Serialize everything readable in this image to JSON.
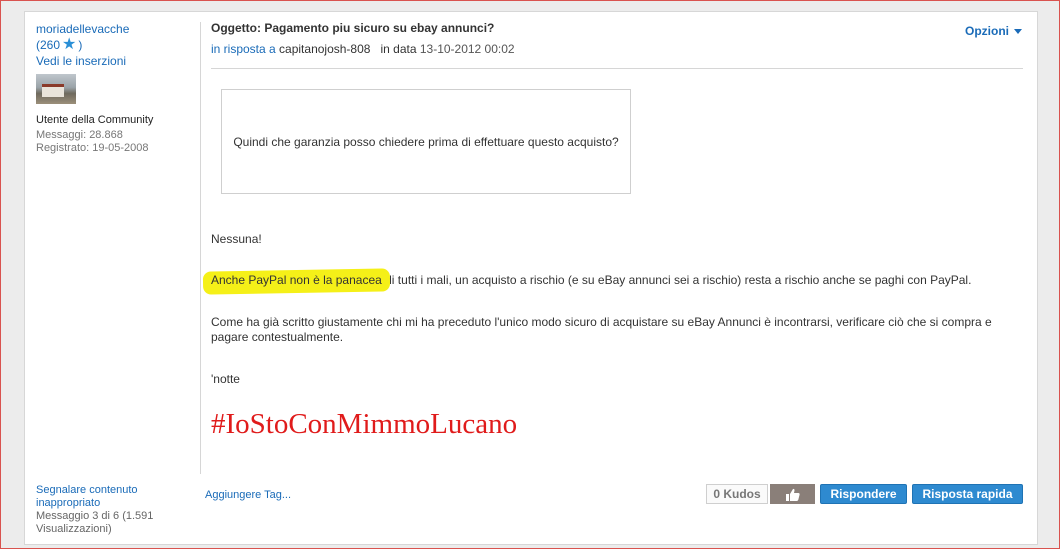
{
  "author": {
    "name": "moriadellevacche",
    "kudos_open": "(260",
    "kudos_close": ")",
    "see_posts": "Vedi le inserzioni",
    "role": "Utente della Community",
    "messages": "Messaggi: 28.868",
    "registered": "Registrato: 19-05-2008"
  },
  "post": {
    "subject": "Oggetto: Pagamento piu sicuro su ebay annunci?",
    "reply_prefix": "in risposta a",
    "reply_to": "capitanojosh-808",
    "date_prefix": "in data",
    "date": "13-10-2012 00:02",
    "options": "Opzioni",
    "quote": "Quindi che garanzia posso chiedere prima di effettuare questo acquisto?",
    "p1": "Nessuna!",
    "p2_highlight": "Anche PayPal non è la panacea",
    "p2_rest": " di tutti i mali, un acquisto a rischio (e su eBay annunci sei a rischio) resta a rischio anche se paghi con PayPal.",
    "p3": "Come ha già scritto giustamente chi mi ha preceduto l'unico modo sicuro di acquistare su eBay Annunci è incontrarsi, verificare ciò che si compra e pagare contestualmente.",
    "p4": "'notte",
    "hashtag": "#IoStoConMimmoLucano"
  },
  "footer": {
    "report": "Segnalare contenuto inappropriato",
    "message_count": "Messaggio 3 di 6 (1.591 Visualizzazioni)",
    "add_tag": "Aggiungere Tag...",
    "kudos": "0 Kudos",
    "reply": "Rispondere",
    "quick_reply": "Risposta rapida"
  },
  "colors": {
    "link": "#1a6bb8",
    "highlight": "#f5f018",
    "hashtag": "#e01b1b",
    "button": "#2e8ad0"
  }
}
